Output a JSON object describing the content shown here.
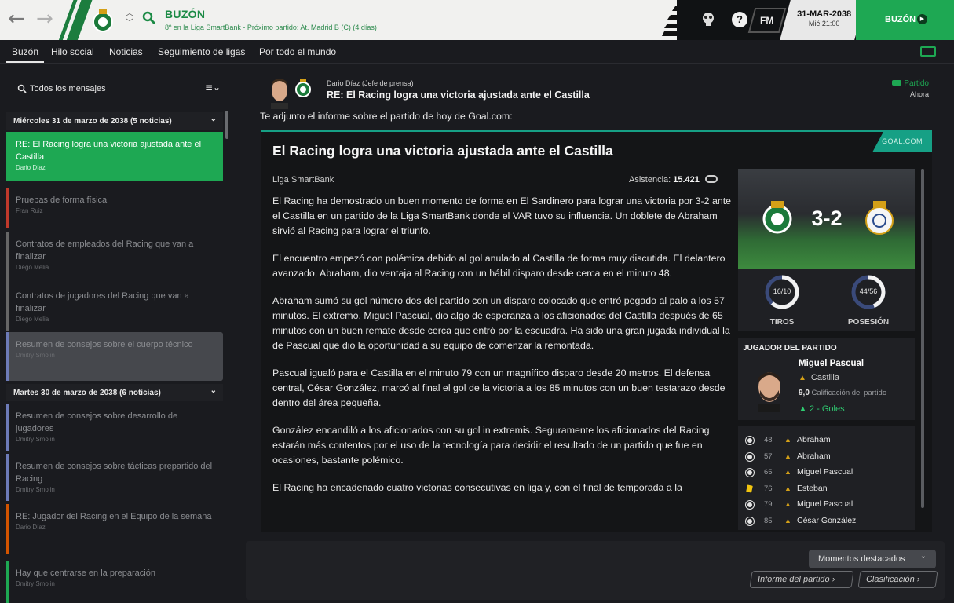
{
  "header": {
    "title": "BUZÓN",
    "subtitle": "8º en la Liga SmartBank - Próximo partido: At. Madrid B (C) (4 días)",
    "fm_label": "FM",
    "date": "31-MAR-2038",
    "time": "Mié 21:00",
    "continue_label": "BUZÓN",
    "help_label": "?"
  },
  "tabs": [
    "Buzón",
    "Hilo social",
    "Noticias",
    "Seguimiento de ligas",
    "Por todo el mundo"
  ],
  "sidebar": {
    "filter_label": "Todos los mensajes",
    "groups": [
      {
        "label": "Miércoles 31 de marzo de 2038 (5 noticias)"
      },
      {
        "label": "Martes 30 de marzo de 2038 (6 noticias)"
      }
    ],
    "messages": [
      {
        "title": "RE: El Racing logra una victoria ajustada ante el Castilla",
        "author": "Dario Díaz",
        "color": "#1ea853"
      },
      {
        "title": "Pruebas de forma física",
        "author": "Fran Ruiz",
        "color": "#c0392b"
      },
      {
        "title": "Contratos de empleados del Racing que van a finalizar",
        "author": "Diego Melia",
        "color": "#666666"
      },
      {
        "title": "Contratos de jugadores del Racing que van a finalizar",
        "author": "Diego Melia",
        "color": "#666666"
      },
      {
        "title": "Resumen de consejos sobre el cuerpo técnico",
        "author": "Dmitry Smolin",
        "color": "#6d7bb8"
      },
      {
        "title": "Resumen de consejos sobre desarrollo de jugadores",
        "author": "Dmitry Smolin",
        "color": "#6d7bb8"
      },
      {
        "title": "Resumen de consejos sobre tácticas prepartido del Racing",
        "author": "Dmitry Smolin",
        "color": "#6d7bb8"
      },
      {
        "title": "RE: Jugador del Racing en el Equipo de la semana",
        "author": "Dario Díaz",
        "color": "#d35400"
      },
      {
        "title": "Hay que centrarse en la preparación",
        "author": "Dmitry Smolin",
        "color": "#1ea853"
      }
    ]
  },
  "message": {
    "sender": "Dario Díaz",
    "sender_role": "(Jefe de prensa)",
    "subject": "RE: El Racing logra una victoria ajustada ante el Castilla",
    "category": "Partido",
    "time": "Ahora",
    "intro": "Te adjunto el informe sobre el partido de hoy de Goal.com:"
  },
  "article": {
    "source": "GOAL.COM",
    "headline": "El Racing logra una victoria ajustada ante el Castilla",
    "competition": "Liga SmartBank",
    "attendance_label": "Asistencia:",
    "attendance": "15.421",
    "paragraphs": [
      "El Racing ha demostrado un buen momento de forma en El Sardinero para lograr una victoria por 3-2 ante el Castilla en un partido de la Liga SmartBank donde el VAR tuvo su influencia. Un doblete de Abraham sirvió al Racing para lograr el triunfo.",
      "El encuentro empezó con polémica debido al gol anulado al Castilla de forma muy discutida. El delantero avanzado, Abraham, dio ventaja al Racing con un hábil disparo desde cerca en el minuto 48.",
      "Abraham sumó su gol número dos del partido con un disparo colocado que entró pegado al palo a los 57 minutos. El extremo, Miguel Pascual, dio algo de esperanza a los aficionados del Castilla después de 65 minutos con un buen remate desde cerca que entró por la escuadra. Ha sido una gran jugada individual la de Pascual que dio la oportunidad a su equipo de comenzar la remontada.",
      "Pascual igualó para el Castilla en el minuto 79 con un magnífico disparo desde 20 metros. El defensa central, César González, marcó al final el gol de la victoria a los 85 minutos con un buen testarazo desde dentro del área pequeña.",
      "González encandiló a los aficionados con su gol in extremis. Seguramente los aficionados del Racing estarán más contentos por el uso de la tecnología para decidir el resultado de un partido que fue en ocasiones, bastante polémico.",
      "El Racing ha encadenado cuatro victorias consecutivas en liga y, con el final de temporada a la"
    ]
  },
  "match": {
    "score": "3-2",
    "shots": "16/10",
    "shots_label": "TIROS",
    "shots_ratio": 0.615,
    "possession": "44/56",
    "possession_label": "POSESIÓN",
    "possession_ratio": 0.44,
    "motm_header": "JUGADOR DEL PARTIDO",
    "motm_name": "Miguel Pascual",
    "motm_club": "Castilla",
    "motm_rating": "9,0",
    "motm_rating_label": "Calificación del partido",
    "motm_goals": "2 - Goles",
    "events": [
      {
        "minute": "48",
        "player": "Abraham",
        "type": "goal"
      },
      {
        "minute": "57",
        "player": "Abraham",
        "type": "goal"
      },
      {
        "minute": "65",
        "player": "Miguel Pascual",
        "type": "goal"
      },
      {
        "minute": "76",
        "player": "Esteban",
        "type": "yellow"
      },
      {
        "minute": "79",
        "player": "Miguel Pascual",
        "type": "goal"
      },
      {
        "minute": "85",
        "player": "César González",
        "type": "goal"
      }
    ]
  },
  "footer": {
    "highlights_label": "Momentos destacados",
    "report_label": "Informe del partido",
    "table_label": "Clasificación"
  }
}
